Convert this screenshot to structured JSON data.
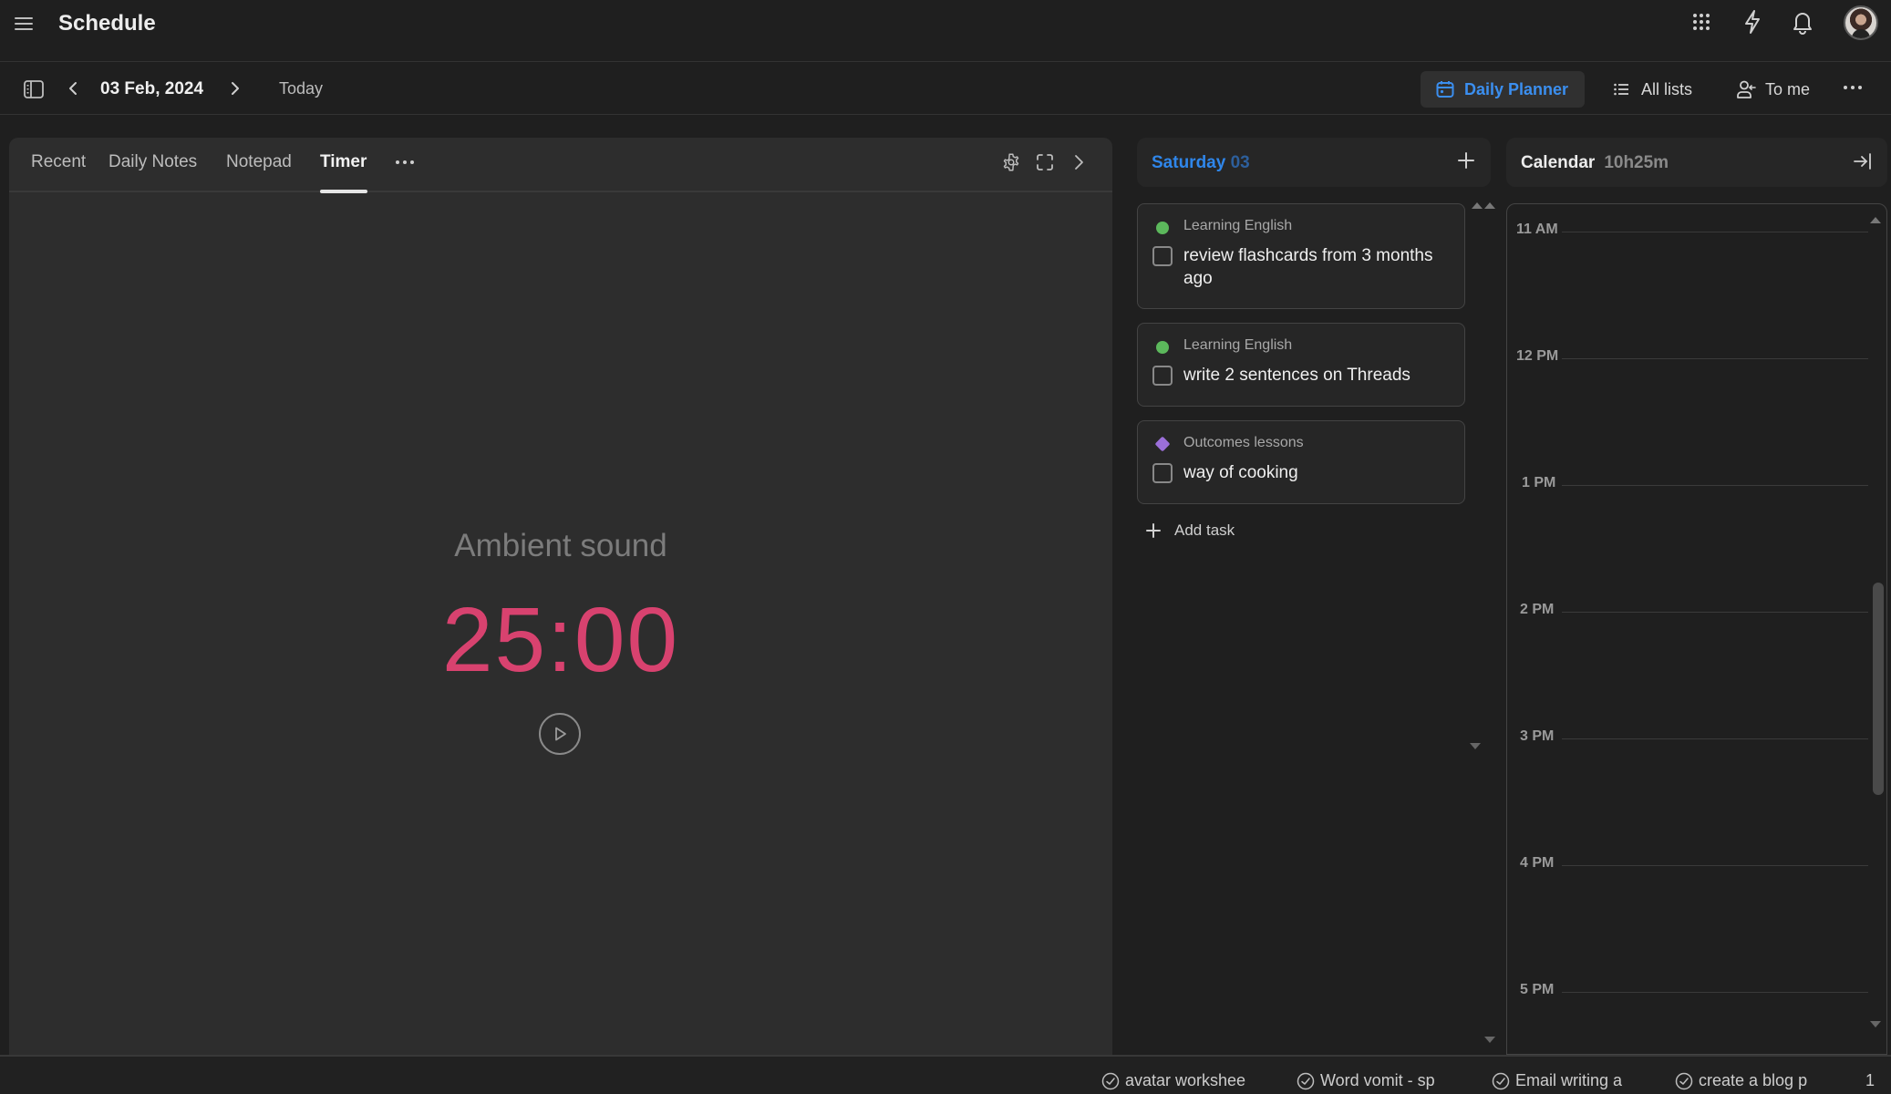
{
  "app": {
    "title": "Schedule"
  },
  "header_icons": {
    "menu": "hamburger-icon",
    "apps": "grid-icon",
    "quick_actions": "lightning-icon",
    "notifications": "bell-icon",
    "profile": "avatar"
  },
  "toolbar": {
    "date": "03 Feb, 2024",
    "today_label": "Today",
    "views": [
      {
        "label": "Daily Planner",
        "icon": "calendar-icon",
        "active": true
      },
      {
        "label": "All lists",
        "icon": "list-icon",
        "active": false
      },
      {
        "label": "To me",
        "icon": "person-arrow-icon",
        "active": false
      }
    ],
    "more_label": "More"
  },
  "left_panel": {
    "tabs": [
      {
        "label": "Recent",
        "active": false
      },
      {
        "label": "Daily Notes",
        "active": false
      },
      {
        "label": "Notepad",
        "active": false
      },
      {
        "label": "Timer",
        "active": true
      }
    ],
    "timer": {
      "ambient_label": "Ambient sound",
      "time": "25:00",
      "time_color": "#d8426f"
    }
  },
  "day_panel": {
    "day_name": "Saturday",
    "day_number": "03",
    "accent": "#2f86ea",
    "tasks": [
      {
        "list": "Learning English",
        "list_color": "#5cb85c",
        "marker": "dot",
        "title": "review flashcards from 3 months ago",
        "done": false
      },
      {
        "list": "Learning English",
        "list_color": "#5cb85c",
        "marker": "dot",
        "title": "write 2 sentences on Threads",
        "done": false
      },
      {
        "list": "Outcomes lessons",
        "list_color": "#9b6fd9",
        "marker": "diamond",
        "title": "way of cooking",
        "done": false
      }
    ],
    "add_task_label": "Add task"
  },
  "calendar_panel": {
    "title": "Calendar",
    "duration": "10h25m",
    "hours": [
      "11 AM",
      "12 PM",
      "1 PM",
      "2 PM",
      "3 PM",
      "4 PM",
      "5 PM"
    ]
  },
  "bottom_bar": {
    "pinned_tasks": [
      {
        "label": "avatar workshee"
      },
      {
        "label": "Word vomit - sp"
      },
      {
        "label": "Email writing a"
      },
      {
        "label": "create a blog p"
      }
    ],
    "count": "1"
  }
}
